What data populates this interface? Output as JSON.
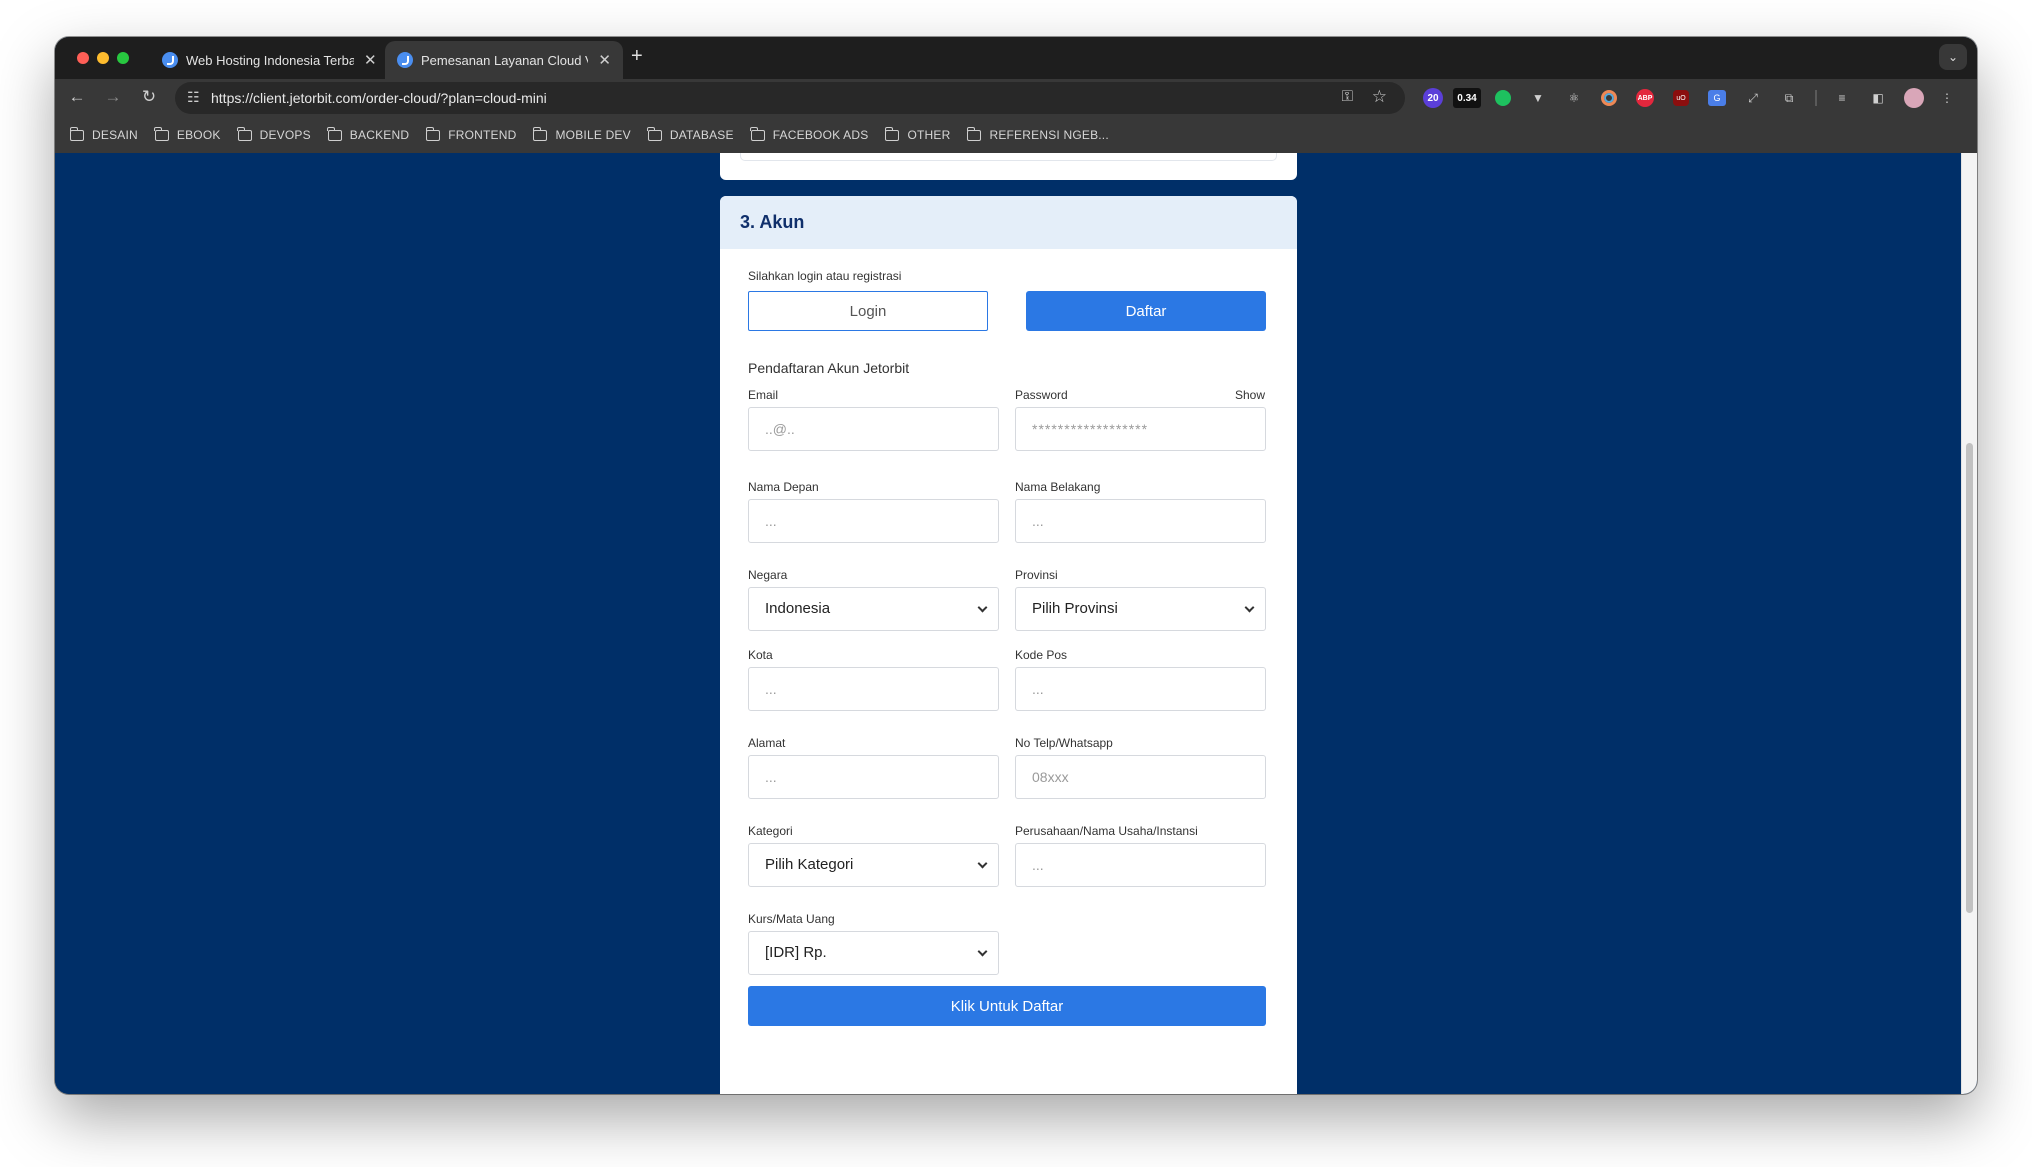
{
  "browser": {
    "tabs": [
      {
        "title": "Web Hosting Indonesia Terbaik"
      },
      {
        "title": "Pemesanan Layanan Cloud VPS"
      }
    ],
    "url": "https://client.jetorbit.com/order-cloud/?plan=cloud-mini",
    "extensions": {
      "badge_count": "20",
      "badge_value": "0.34"
    },
    "bookmarks": [
      "DESAIN",
      "EBOOK",
      "DEVOPS",
      "BACKEND",
      "FRONTEND",
      "MOBILE DEV",
      "DATABASE",
      "FACEBOOK ADS",
      "OTHER",
      "REFERENSI NGEB..."
    ]
  },
  "section": {
    "title": "3. Akun",
    "login_prompt": "Silahkan login atau registrasi",
    "login_label": "Login",
    "register_label": "Daftar",
    "subtitle": "Pendaftaran Akun Jetorbit"
  },
  "form": {
    "email": {
      "label": "Email",
      "placeholder": "..@.."
    },
    "password": {
      "label": "Password",
      "show_label": "Show",
      "placeholder": "******************"
    },
    "first_name": {
      "label": "Nama Depan",
      "placeholder": "..."
    },
    "last_name": {
      "label": "Nama Belakang",
      "placeholder": "..."
    },
    "country": {
      "label": "Negara",
      "value": "Indonesia"
    },
    "province": {
      "label": "Provinsi",
      "value": "Pilih Provinsi"
    },
    "city": {
      "label": "Kota",
      "placeholder": "..."
    },
    "postal_code": {
      "label": "Kode Pos",
      "placeholder": "..."
    },
    "address": {
      "label": "Alamat",
      "placeholder": "..."
    },
    "phone": {
      "label": "No Telp/Whatsapp",
      "placeholder": "08xxx"
    },
    "category": {
      "label": "Kategori",
      "value": "Pilih Kategori"
    },
    "company": {
      "label": "Perusahaan/Nama Usaha/Instansi",
      "placeholder": "..."
    },
    "currency": {
      "label": "Kurs/Mata Uang",
      "value": "[IDR] Rp."
    },
    "submit_label": "Klik Untuk Daftar"
  },
  "colors": {
    "page_bg": "#002f68",
    "accent": "#2b78e4",
    "header_bg": "#e4eef9",
    "title": "#0f2f6b"
  }
}
